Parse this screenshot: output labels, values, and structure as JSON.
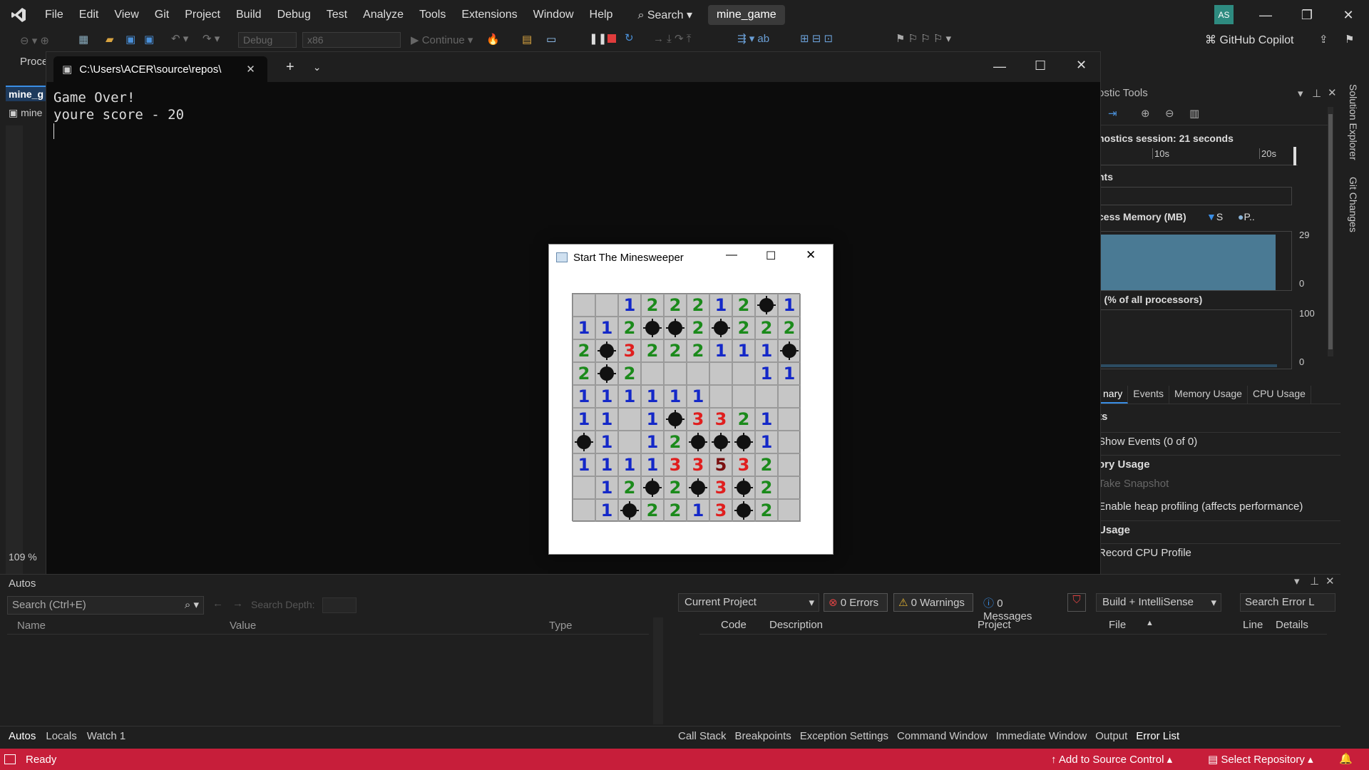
{
  "menubar": {
    "items": [
      "File",
      "Edit",
      "View",
      "Git",
      "Project",
      "Build",
      "Debug",
      "Test",
      "Analyze",
      "Tools",
      "Extensions",
      "Window",
      "Help"
    ],
    "search_label": "Search",
    "solution_name": "mine_game",
    "avatar_initials": "AS"
  },
  "toolbar": {
    "config": "Debug",
    "platform": "x86",
    "continue_label": "Continue",
    "copilot_label": "GitHub Copilot"
  },
  "left": {
    "process_label": "Proce",
    "doc_tab": "mine_g",
    "doc_item": "mine",
    "zoom": "109 %"
  },
  "terminal": {
    "tab_title": "C:\\Users\\ACER\\source\\repos\\",
    "lines": [
      "Game Over!",
      "youre score - 20"
    ]
  },
  "minesweeper": {
    "title": "Start The Minesweeper",
    "grid": [
      [
        "",
        "",
        "1",
        "2",
        "2",
        "2",
        "1",
        "2",
        "*",
        "1"
      ],
      [
        "1",
        "1",
        "2",
        "*",
        "*",
        "2",
        "*",
        "2",
        "2",
        "2"
      ],
      [
        "2",
        "*",
        "3",
        "2",
        "2",
        "2",
        "1",
        "1",
        "1",
        "*"
      ],
      [
        "2",
        "*",
        "2",
        "",
        "",
        "",
        "",
        "",
        "1",
        "1"
      ],
      [
        "1",
        "1",
        "1",
        "1",
        "1",
        "1",
        "",
        "",
        "",
        ""
      ],
      [
        "1",
        "1",
        "",
        "1",
        "*",
        "3",
        "3",
        "2",
        "1",
        ""
      ],
      [
        "*",
        "1",
        "",
        "1",
        "2",
        "*",
        "*",
        "*",
        "1",
        ""
      ],
      [
        "1",
        "1",
        "1",
        "1",
        "3",
        "3",
        "5",
        "3",
        "2",
        ""
      ],
      [
        "",
        "1",
        "2",
        "*",
        "2",
        "*",
        "3",
        "*",
        "2",
        ""
      ],
      [
        "",
        "1",
        "*",
        "2",
        "2",
        "1",
        "3",
        "*",
        "2",
        ""
      ]
    ]
  },
  "diagnostics": {
    "title": "ostic Tools",
    "session": "nostics session: 21 seconds",
    "tick_10s": "10s",
    "tick_20s": "20s",
    "events_label": "nts",
    "memory_label": "cess Memory (MB)",
    "legend_s": "S",
    "legend_p": "P..",
    "mem_max": "29",
    "mem_min": "0",
    "cpu_label": ") (% of all processors)",
    "cpu_max": "100",
    "cpu_min": "0",
    "tabs": [
      "nary",
      "Events",
      "Memory Usage",
      "CPU Usage"
    ],
    "section_events": "ts",
    "show_events": "Show Events (0 of 0)",
    "section_memory": "ory Usage",
    "take_snapshot": "Take Snapshot",
    "heap_profiling": "Enable heap profiling (affects performance)",
    "section_cpu": "Usage",
    "record_cpu": "Record CPU Profile"
  },
  "vertical_tabs": [
    "Solution Explorer",
    "Git Changes"
  ],
  "autos": {
    "title": "Autos",
    "search_placeholder": "Search (Ctrl+E)",
    "search_depth": "Search Depth:",
    "columns": [
      "Name",
      "Value",
      "Type"
    ],
    "tabs": [
      "Autos",
      "Locals",
      "Watch 1"
    ]
  },
  "errorlist": {
    "scope": "Current Project",
    "errors": "0 Errors",
    "warnings": "0 Warnings",
    "messages": "0 Messages",
    "build_filter": "Build + IntelliSense",
    "search": "Search Error L",
    "columns": [
      "Code",
      "Description",
      "Project",
      "File",
      "Line",
      "Details"
    ],
    "tabs": [
      "Call Stack",
      "Breakpoints",
      "Exception Settings",
      "Command Window",
      "Immediate Window",
      "Output",
      "Error List"
    ]
  },
  "status": {
    "ready": "Ready",
    "add_source": "Add to Source Control",
    "select_repo": "Select Repository"
  },
  "colors": {
    "accent": "#c71e3a",
    "terminal_bg": "#0c0c0c",
    "num1": "#1428c8",
    "num2": "#1b8a1b",
    "num3": "#e01e1e"
  }
}
